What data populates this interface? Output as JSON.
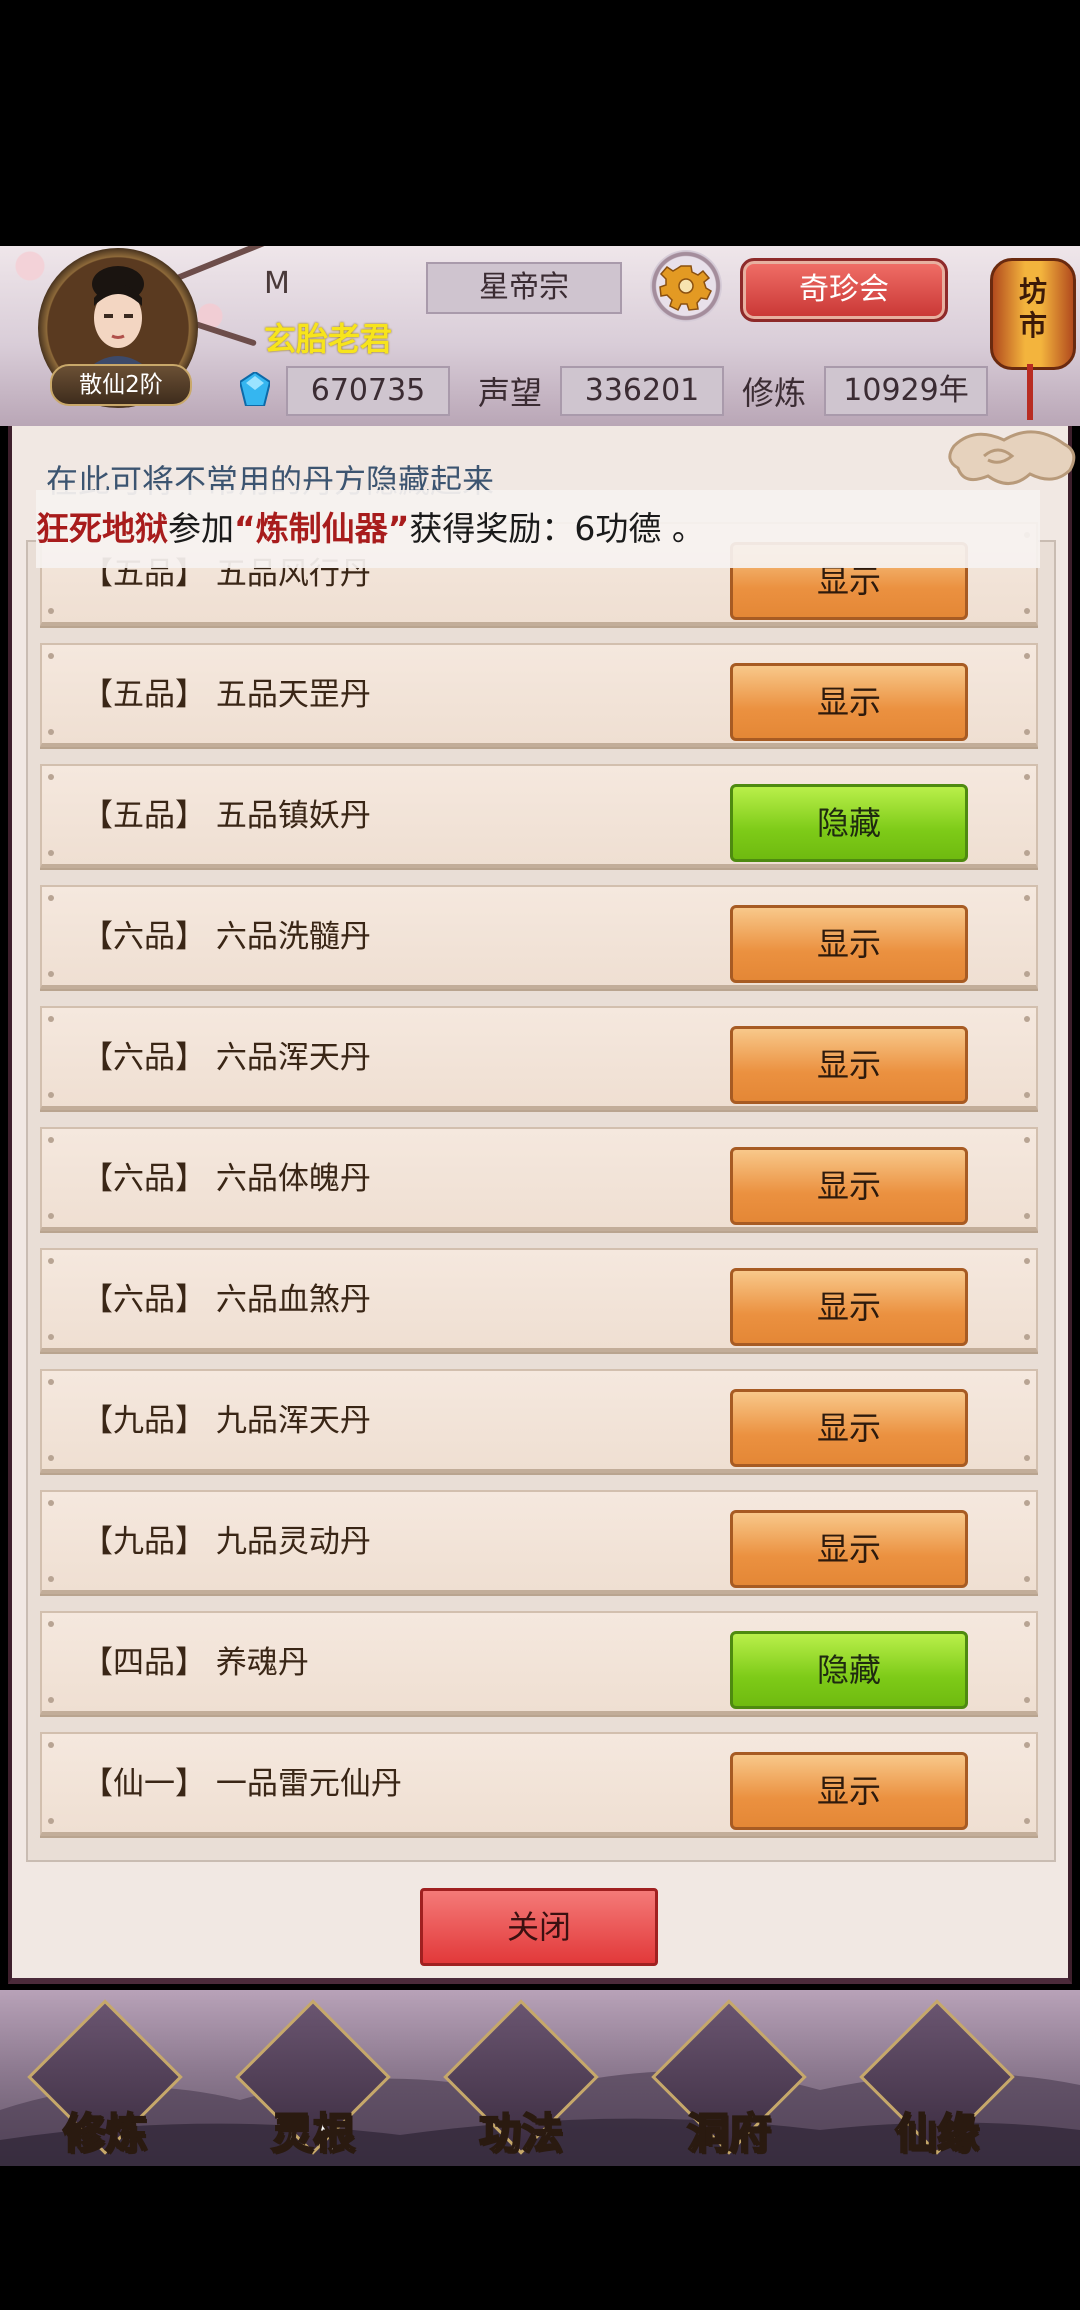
{
  "header": {
    "rank": "散仙2阶",
    "player_letter": "M",
    "player_name": "玄胎老君",
    "sect": "星帝宗",
    "qizhen_button": "奇珍会",
    "market_label": "坊市",
    "spirit_stones": "670735",
    "prestige_label": "声望",
    "prestige": "336201",
    "cultivation_label": "修炼",
    "cultivation": "10929年"
  },
  "panel": {
    "hint": "在此可将不常用的丹方隐藏起来",
    "ticker": {
      "name": "狂死地狱",
      "pre": "参加",
      "event": "“炼制仙器”",
      "post": "获得奖励：6功德 。"
    },
    "recipes": [
      {
        "label": "【五品】 五品风行丹",
        "action": "显示",
        "state": "show"
      },
      {
        "label": "【五品】 五品天罡丹",
        "action": "显示",
        "state": "show"
      },
      {
        "label": "【五品】 五品镇妖丹",
        "action": "隐藏",
        "state": "hide"
      },
      {
        "label": "【六品】 六品洗髓丹",
        "action": "显示",
        "state": "show"
      },
      {
        "label": "【六品】 六品浑天丹",
        "action": "显示",
        "state": "show"
      },
      {
        "label": "【六品】 六品体魄丹",
        "action": "显示",
        "state": "show"
      },
      {
        "label": "【六品】 六品血煞丹",
        "action": "显示",
        "state": "show"
      },
      {
        "label": "【九品】 九品浑天丹",
        "action": "显示",
        "state": "show"
      },
      {
        "label": "【九品】 九品灵动丹",
        "action": "显示",
        "state": "show"
      },
      {
        "label": "【四品】 养魂丹",
        "action": "隐藏",
        "state": "hide"
      },
      {
        "label": "【仙一】 一品雷元仙丹",
        "action": "显示",
        "state": "show"
      }
    ],
    "close_label": "关闭"
  },
  "nav": [
    {
      "label": "修炼",
      "icon": "monk-icon",
      "active": true
    },
    {
      "label": "灵根",
      "icon": "sword-icon",
      "active": false
    },
    {
      "label": "功法",
      "icon": "book-icon",
      "active": false
    },
    {
      "label": "洞府",
      "icon": "pagoda-icon",
      "active": false
    },
    {
      "label": "仙缘",
      "icon": "gourd-icon",
      "active": false
    }
  ],
  "colors": {
    "show_button": "#eb9140",
    "hide_button": "#7ecb18",
    "close_button": "#e2393a",
    "player_name": "#f7e41c"
  }
}
